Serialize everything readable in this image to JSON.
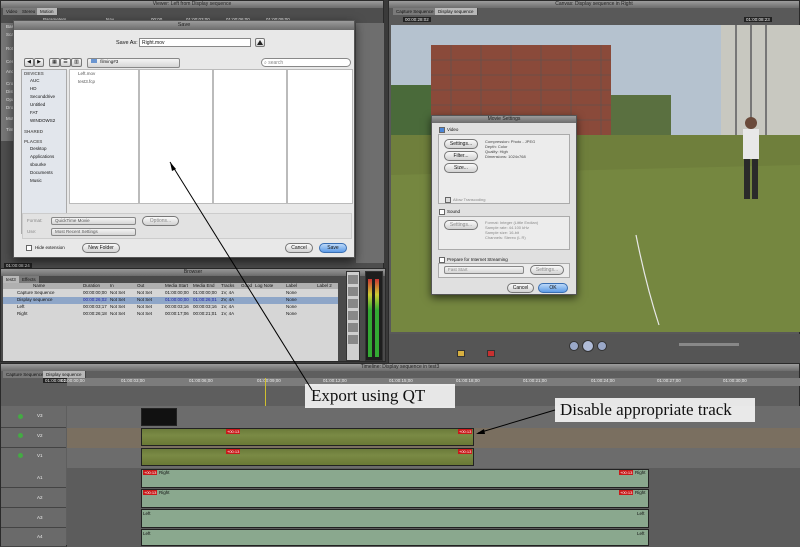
{
  "viewer": {
    "title": "Viewer: Left from Display sequence",
    "tabs": [
      "Video",
      "Stereo",
      "Motion"
    ],
    "tc_left": "01:00:08:24",
    "params_hdr": "Parameters",
    "nav_hdr": "Nav",
    "ruler": [
      "00:00",
      "01:00:03:00",
      "01:00:06:00",
      "01:00:09:00"
    ],
    "rows": [
      "Basic M...",
      "Scale",
      "Rotation",
      "Center",
      "Anchor",
      "Crop",
      "Distort",
      "Opacity",
      "Drop S...",
      "Motion B...",
      "Time Re..."
    ]
  },
  "canvas": {
    "title": "Canvas: Display sequence in Right",
    "tabs": [
      "Capture Sequence",
      "Display sequence"
    ],
    "tc": "00:00:28:02",
    "tc2": "01:00:08:23"
  },
  "save_dialog": {
    "title": "Save",
    "save_as_label": "Save As:",
    "save_as_value": "Right.mov",
    "folder": "filming#3",
    "search_placeholder": "search",
    "devices_hdr": "DEVICES",
    "devices": [
      "AUC",
      "HD",
      "Seconddrive",
      "Untitled",
      "FAT",
      "WINDOWS2"
    ],
    "shared_hdr": "SHARED",
    "places_hdr": "PLACES",
    "places": [
      "Desktop",
      "Applications",
      "sbourke",
      "Documents",
      "Music"
    ],
    "files": [
      "Left.mov",
      "test3.fcp"
    ],
    "format_label": "Format:",
    "format_value": "QuickTime Movie",
    "options_label": "Options...",
    "use_label": "Use:",
    "use_value": "Most Recent Settings",
    "hide_ext": "Hide extension",
    "new_folder": "New Folder",
    "cancel": "Cancel",
    "save": "Save"
  },
  "movie_settings": {
    "title": "Movie Settings",
    "video_label": "Video",
    "settings_btn": "Settings...",
    "filter_btn": "Filter...",
    "size_btn": "Size...",
    "video_info": [
      "Compression: Photo - JPEG",
      "Depth: Color",
      "Quality: High",
      "Dimensions: 1024x768"
    ],
    "allow_transcoding": "Allow Transcoding",
    "sound_label": "Sound",
    "sound_settings": "Settings...",
    "sound_info": [
      "Format: Integer (Little Endian)",
      "Sample rate: 44.100 kHz",
      "Sample size: 16-bit",
      "Channels: Stereo (L R)"
    ],
    "prepare_label": "Prepare for Internet Streaming",
    "stream_value": "Fast Start",
    "stream_settings": "Settings...",
    "cancel": "Cancel",
    "ok": "OK"
  },
  "browser": {
    "title": "Browser",
    "tabs": [
      "test3",
      "Effects"
    ],
    "columns": [
      "Name",
      "Duration",
      "In",
      "Out",
      "Media Start",
      "Media End",
      "Tracks",
      "Good",
      "Log Note",
      "Label",
      "Label 2"
    ],
    "rows": [
      [
        "Capture Sequence",
        "00:00:00;00",
        "Not Set",
        "Not Set",
        "01:00:00;00",
        "01:00:00;00",
        "1V, 4A",
        "",
        "",
        "None",
        ""
      ],
      [
        "Display sequence",
        "00:00:26;02",
        "Not Set",
        "Not Set",
        "01:00:00;00",
        "01:00:26;01",
        "2V, 4A",
        "",
        "",
        "None",
        ""
      ],
      [
        "Left",
        "00:00:03;17",
        "Not Set",
        "Not Set",
        "00:00:03;16",
        "00:00:03;16",
        "1V, 4A",
        "",
        "",
        "None",
        ""
      ],
      [
        "Right",
        "00:00:26;18",
        "Not Set",
        "Not Set",
        "00:00:17;06",
        "00:00:21;01",
        "1V, 4A",
        "",
        "",
        "None",
        ""
      ]
    ]
  },
  "timeline": {
    "title": "Timeline: Display sequence in test3",
    "tabs": [
      "Capture Sequence",
      "Display sequence"
    ],
    "tc": "01:00:08:24",
    "ruler": [
      "01:00:00;00",
      "01:00:03;00",
      "01:00:06;00",
      "01:00:09;00",
      "01:00:12;00",
      "01:00:15;00",
      "01:00:18;00",
      "01:00:21;00",
      "01:00:24;00",
      "01:00:27;00",
      "01:00:30;00"
    ],
    "tracks": [
      "V3",
      "V2",
      "V1",
      "A1",
      "A2",
      "A3",
      "A4"
    ],
    "clip_badge": "+00:13",
    "audio_name": "Right",
    "left_name": "Left"
  },
  "annotations": {
    "export": "Export using QT",
    "disable": "Disable appropriate track"
  },
  "colors": {
    "badge": "#c81a1a",
    "accent": "#4a86d8"
  }
}
